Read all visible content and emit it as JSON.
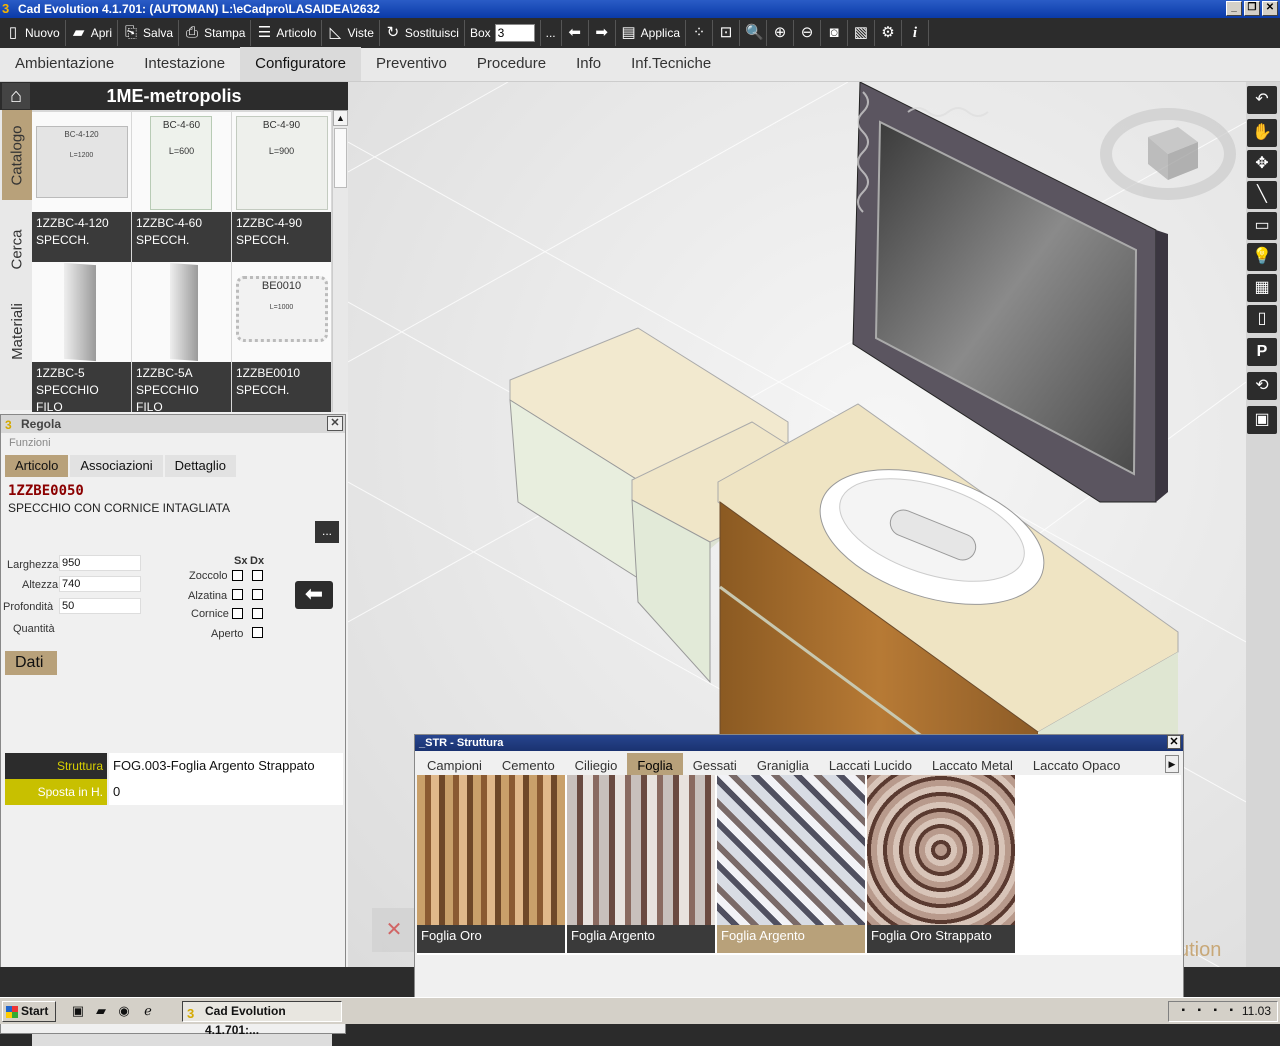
{
  "window": {
    "title": "Cad Evolution 4.1.701: (AUTOMAN)  L:\\eCadpro\\LASAIDEA\\2632"
  },
  "toolbar": {
    "nuovo": "Nuovo",
    "apri": "Apri",
    "salva": "Salva",
    "stampa": "Stampa",
    "articolo": "Articolo",
    "viste": "Viste",
    "sostituisci": "Sostituisci",
    "box_label": "Box",
    "box_value": "3",
    "ellipsis": "...",
    "applica": "Applica"
  },
  "main_tabs": [
    "Ambientazione",
    "Intestazione",
    "Configuratore",
    "Preventivo",
    "Procedure",
    "Info",
    "Inf.Tecniche"
  ],
  "catalog": {
    "title": "1ME-metropolis",
    "side_tabs": [
      "Catalogo",
      "Cerca",
      "Materiali"
    ],
    "items": [
      {
        "code": "1ZZBC-4-120",
        "desc": "SPECCH.",
        "thumb_top": "BC-4-120",
        "thumb_bottom": "L=1200"
      },
      {
        "code": "1ZZBC-4-60",
        "desc": "SPECCH.",
        "thumb_top": "BC-4-60",
        "thumb_bottom": "L=600"
      },
      {
        "code": "1ZZBC-4-90",
        "desc": "SPECCH.",
        "thumb_top": "BC-4-90",
        "thumb_bottom": "L=900"
      },
      {
        "code": "1ZZBC-5",
        "desc": "SPECCHIO FILO",
        "thumb_top": "",
        "thumb_bottom": ""
      },
      {
        "code": "1ZZBC-5A",
        "desc": "SPECCHIO FILO",
        "thumb_top": "",
        "thumb_bottom": ""
      },
      {
        "code": "1ZZBE0010",
        "desc": "SPECCH.",
        "thumb_top": "BE0010",
        "thumb_bottom": "L=1000"
      }
    ]
  },
  "regola": {
    "title": "Regola",
    "funzioni": "Funzioni",
    "tabs": [
      "Articolo",
      "Associazioni",
      "Dettaglio"
    ],
    "code": "1ZZBE0050",
    "description": "SPECCHIO CON CORNICE INTAGLIATA",
    "dots": "...",
    "larghezza_label": "Larghezza",
    "larghezza": "950",
    "altezza_label": "Altezza",
    "altezza": "740",
    "profondita_label": "Profondità",
    "profondita": "50",
    "quantita_label": "Quantità",
    "sx": "Sx",
    "dx": "Dx",
    "zoccolo": "Zoccolo",
    "alzatina": "Alzatina",
    "cornice": "Cornice",
    "aperto": "Aperto",
    "dati_label": "Dati",
    "struttura_label": "Struttura",
    "struttura_value": "FOG.003-Foglia Argento Strappato",
    "sposta_label": "Sposta in H.",
    "sposta_value": "0"
  },
  "str_window": {
    "title": "_STR - Struttura",
    "tabs": [
      "Campioni",
      "Cemento",
      "Ciliegio",
      "Foglia",
      "Gessati",
      "Graniglia",
      "Laccati Lucido",
      "Laccato Metal",
      "Laccato Opaco"
    ],
    "active_tab": "Foglia",
    "swatches": [
      {
        "label": "Foglia Oro",
        "selected": false
      },
      {
        "label": "Foglia Argento",
        "selected": false
      },
      {
        "label": "Foglia Argento",
        "selected": true
      },
      {
        "label": "Foglia Oro Strappato",
        "selected": false
      }
    ]
  },
  "viewport": {
    "watermark": "ution"
  },
  "taskbar": {
    "start": "Start",
    "task": "Cad Evolution 4.1.701:...",
    "clock": "11.03"
  },
  "colors": {
    "accent": "#b8a17a",
    "dark": "#2c2c2c",
    "highlight": "#d8d000"
  }
}
